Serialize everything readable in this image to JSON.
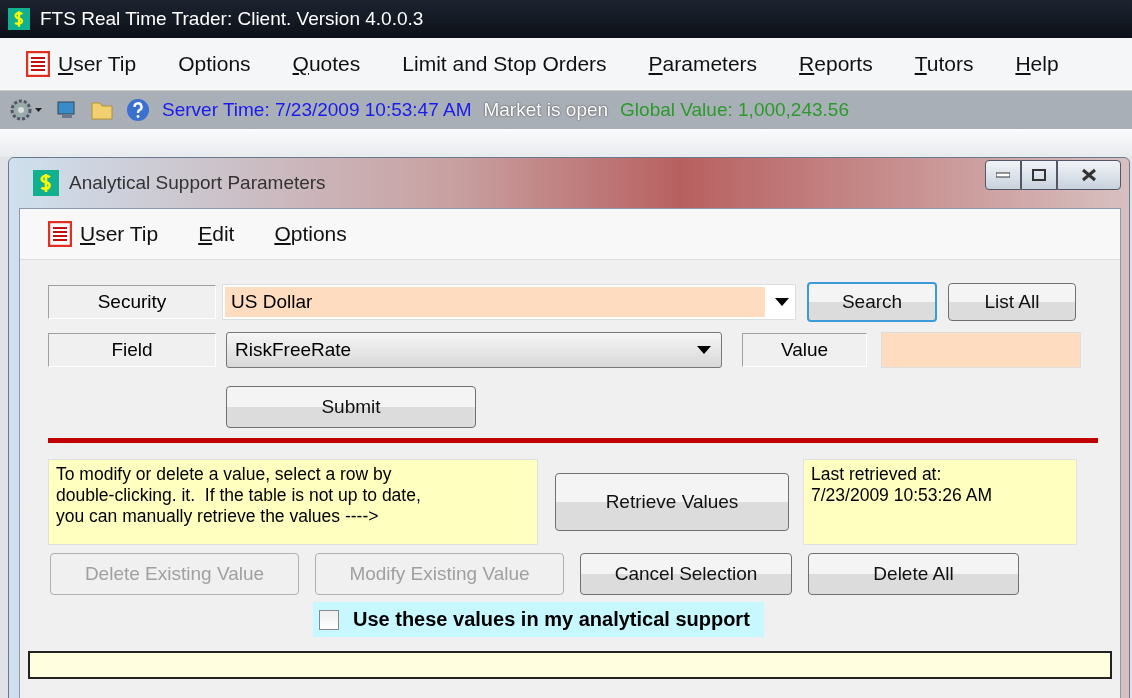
{
  "window": {
    "title": "FTS Real Time Trader: Client. Version 4.0.0.3"
  },
  "menu": [
    {
      "label": "User Tip",
      "access_key": true,
      "kind": "tip"
    },
    {
      "label": "Options",
      "access_key": false
    },
    {
      "label": "Quotes",
      "access_key": true
    },
    {
      "label": "Limit and Stop Orders",
      "access_key": false
    },
    {
      "label": "Parameters",
      "access_key": true
    },
    {
      "label": "Reports",
      "access_key": true
    },
    {
      "label": "Tutors",
      "access_key": true
    },
    {
      "label": "Help",
      "access_key": true
    }
  ],
  "toolbar": {
    "server_time": "Server Time: 7/23/2009 10:53:47 AM",
    "market_status": "Market is open",
    "global_value": "Global Value: 1,000,243.56"
  },
  "dialog": {
    "title": "Analytical Support Parameters",
    "menu": [
      {
        "label": "User Tip",
        "access_key": true,
        "kind": "tip"
      },
      {
        "label": "Edit",
        "access_key": true
      },
      {
        "label": "Options",
        "access_key": true
      }
    ],
    "security": {
      "label": "Security",
      "value": "US Dollar"
    },
    "search_button": {
      "label": "Search",
      "focused": true
    },
    "list_all_button": {
      "label": "List All"
    },
    "field": {
      "label": "Field",
      "value": "RiskFreeRate"
    },
    "value": {
      "label": "Value"
    },
    "submit_button": {
      "label": "Submit"
    },
    "note": "To modify or delete a value, select a row by\ndouble-clicking. it.  If the table is not up to date,\nyou can manually retrieve the values ---->",
    "retrieve_button": {
      "label": "Retrieve Values"
    },
    "last_retrieved": "Last retrieved at:\n7/23/2009 10:53:26 AM",
    "actions": [
      {
        "label": "Delete Existing Value",
        "disabled": true
      },
      {
        "label": "Modify Existing Value",
        "disabled": true
      },
      {
        "label": "Cancel Selection",
        "disabled": false
      },
      {
        "label": "Delete All",
        "disabled": false
      }
    ],
    "use_values": {
      "label": "Use these values in my analytical support",
      "checked": false
    }
  }
}
